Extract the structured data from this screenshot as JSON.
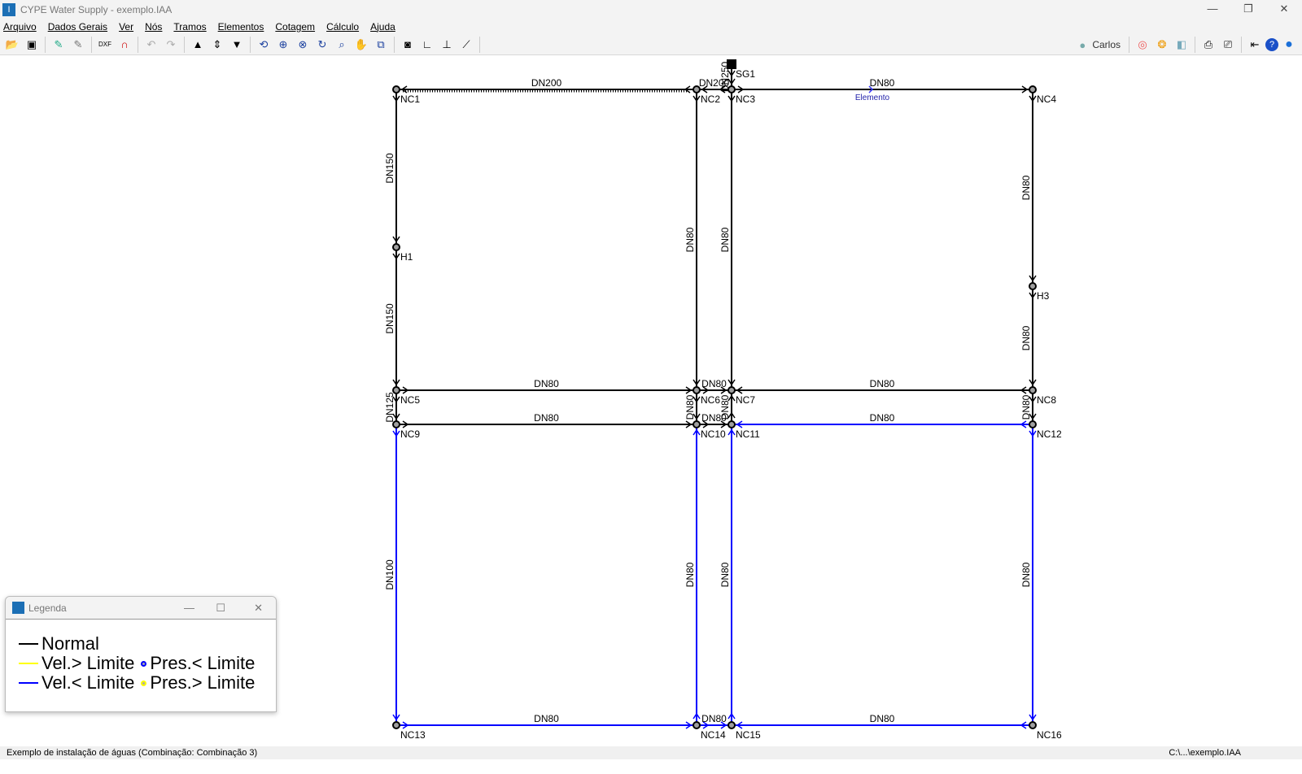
{
  "window": {
    "title": "CYPE Water Supply - exemplo.IAA",
    "minimize": "—",
    "restore": "❐",
    "close": "✕"
  },
  "menu": [
    "Arquivo",
    "Dados Gerais",
    "Ver",
    "Nós",
    "Tramos",
    "Elementos",
    "Cotagem",
    "Cálculo",
    "Ajuda"
  ],
  "toolbar": {
    "icons": [
      "open-folder",
      "save",
      "edit-tool",
      "edit-tool-gray",
      "dxf-dwg",
      "magnet",
      "undo",
      "redo",
      "up",
      "up-down",
      "down",
      "zoom-previous",
      "zoom-all",
      "zoom-x2",
      "redraw",
      "zoom-window",
      "pan",
      "view-window",
      "binoculars",
      "axes-xy",
      "axes-angle",
      "dimension"
    ],
    "user": "Carlos"
  },
  "network": {
    "nodes": [
      "NC1",
      "NC2",
      "NC3",
      "NC4",
      "H1",
      "H3",
      "NC5",
      "NC6",
      "NC7",
      "NC8",
      "NC9",
      "NC10",
      "NC11",
      "NC12",
      "NC13",
      "NC14",
      "NC15",
      "NC16",
      "SG1"
    ],
    "pipes": [
      {
        "from": "NC2",
        "to": "NC1",
        "dn": "DN200",
        "status": "normal"
      },
      {
        "from": "NC3",
        "to": "NC2",
        "dn": "DN200",
        "status": "normal"
      },
      {
        "from": "SG1",
        "to": "NC3",
        "dn": "DN250",
        "status": "normal"
      },
      {
        "from": "NC3",
        "to": "NC4",
        "dn": "DN80",
        "status": "normal"
      },
      {
        "from": "NC1",
        "to": "H1",
        "dn": "DN150",
        "status": "normal"
      },
      {
        "from": "H1",
        "to": "NC5",
        "dn": "DN150",
        "status": "normal"
      },
      {
        "from": "NC2",
        "to": "NC6",
        "dn": "DN80",
        "status": "normal"
      },
      {
        "from": "NC3",
        "to": "NC7",
        "dn": "DN80",
        "status": "normal"
      },
      {
        "from": "NC4",
        "to": "H3",
        "dn": "DN80",
        "status": "normal"
      },
      {
        "from": "H3",
        "to": "NC8",
        "dn": "DN80",
        "status": "normal"
      },
      {
        "from": "NC5",
        "to": "NC6",
        "dn": "DN80",
        "status": "normal"
      },
      {
        "from": "NC6",
        "to": "NC7",
        "dn": "DN80",
        "status": "normal"
      },
      {
        "from": "NC8",
        "to": "NC7",
        "dn": "DN80",
        "status": "normal"
      },
      {
        "from": "NC5",
        "to": "NC9",
        "dn": "DN125",
        "status": "normal"
      },
      {
        "from": "NC6",
        "to": "NC10",
        "dn": "DN80",
        "status": "normal"
      },
      {
        "from": "NC11",
        "to": "NC7",
        "dn": "DN80",
        "status": "normal"
      },
      {
        "from": "NC8",
        "to": "NC12",
        "dn": "DN80",
        "status": "normal"
      },
      {
        "from": "NC9",
        "to": "NC10",
        "dn": "DN80",
        "status": "normal"
      },
      {
        "from": "NC10",
        "to": "NC11",
        "dn": "DN80",
        "status": "normal"
      },
      {
        "from": "NC12",
        "to": "NC11",
        "dn": "DN80",
        "status": "low"
      },
      {
        "from": "NC9",
        "to": "NC13",
        "dn": "DN100",
        "status": "low"
      },
      {
        "from": "NC14",
        "to": "NC10",
        "dn": "DN80",
        "status": "low"
      },
      {
        "from": "NC15",
        "to": "NC11",
        "dn": "DN80",
        "status": "low"
      },
      {
        "from": "NC12",
        "to": "NC16",
        "dn": "DN80",
        "status": "low"
      },
      {
        "from": "NC13",
        "to": "NC14",
        "dn": "DN80",
        "status": "low"
      },
      {
        "from": "NC14",
        "to": "NC15",
        "dn": "DN80",
        "status": "low"
      },
      {
        "from": "NC16",
        "to": "NC15",
        "dn": "DN80",
        "status": "low"
      }
    ],
    "element_label": "Elemento"
  },
  "colors": {
    "normal": "#000000",
    "low": "#0000ff",
    "high": "#ffff00",
    "node_fill": "#a0a0a0"
  },
  "legend": {
    "title": "Legenda",
    "normal": "Normal",
    "vel_high": "Vel.> Limite",
    "vel_low": "Vel.< Limite",
    "pres_low": "Pres.< Limite",
    "pres_high": "Pres.> Limite"
  },
  "status": {
    "left": "Exemplo de instalação de águas (Combinação: Combinação 3)",
    "right": "C:\\...\\exemplo.IAA"
  }
}
